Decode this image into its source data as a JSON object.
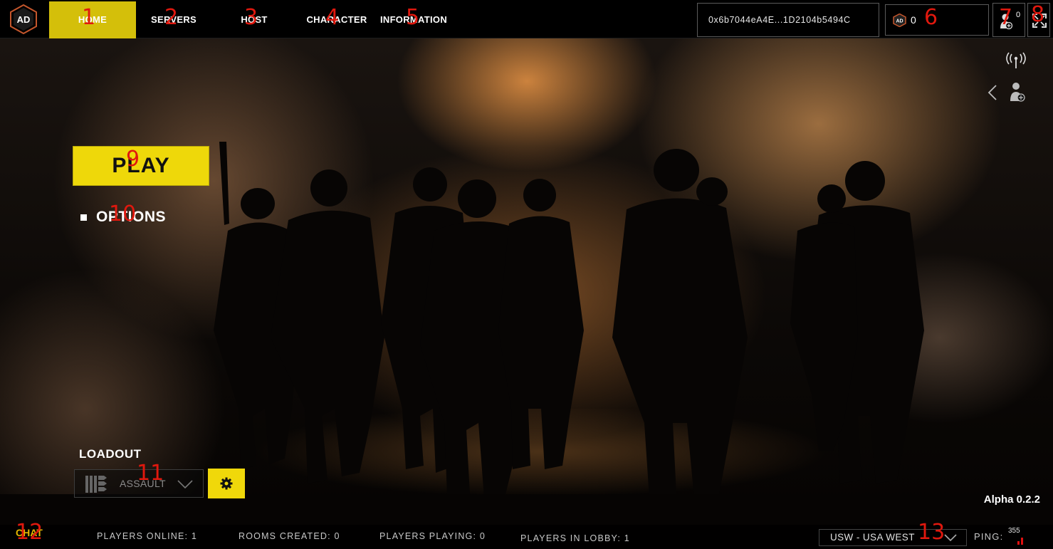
{
  "nav": {
    "items": [
      {
        "label": "HOME",
        "active": true
      },
      {
        "label": "SERVERS"
      },
      {
        "label": "HOST"
      },
      {
        "label": "CHARACTER"
      },
      {
        "label": "INFORMATION"
      }
    ]
  },
  "account": {
    "wallet_address": "0x6b7044eA4E...1D2104b5494C",
    "token_balance": "0",
    "friends_count": "0"
  },
  "main": {
    "play_label": "PLAY",
    "options_label": "OPTIONS",
    "loadout_title": "LOADOUT",
    "loadout_value": "ASSAULT",
    "version": "Alpha 0.2.2"
  },
  "footer": {
    "chat_label": "CHAT",
    "players_online": "PLAYERS ONLINE: 1",
    "rooms_created": "ROOMS CREATED: 0",
    "players_playing": "PLAYERS PLAYING: 0",
    "players_in_lobby": "PLAYERS IN LOBBY: 1",
    "region": "USW - USA WEST",
    "ping_label": "PING:",
    "ping_value": "355"
  },
  "markers": [
    "1",
    "2",
    "3",
    "4",
    "5",
    "6",
    "7",
    "8",
    "9",
    "10",
    "11",
    "12",
    "13"
  ],
  "colors": {
    "accent_yellow": "#eed80a",
    "nav_active": "#d4bf0a",
    "chat": "#e6b800",
    "marker_red": "#e0180e",
    "ping_bar": "#e01010"
  },
  "icons": [
    "logo-icon",
    "coin-icon",
    "add-friend-icon",
    "fullscreen-icon",
    "signal-icon",
    "chevron-left-icon",
    "ammo-icon",
    "chevron-down-icon",
    "gear-icon",
    "ping-bars-icon"
  ]
}
